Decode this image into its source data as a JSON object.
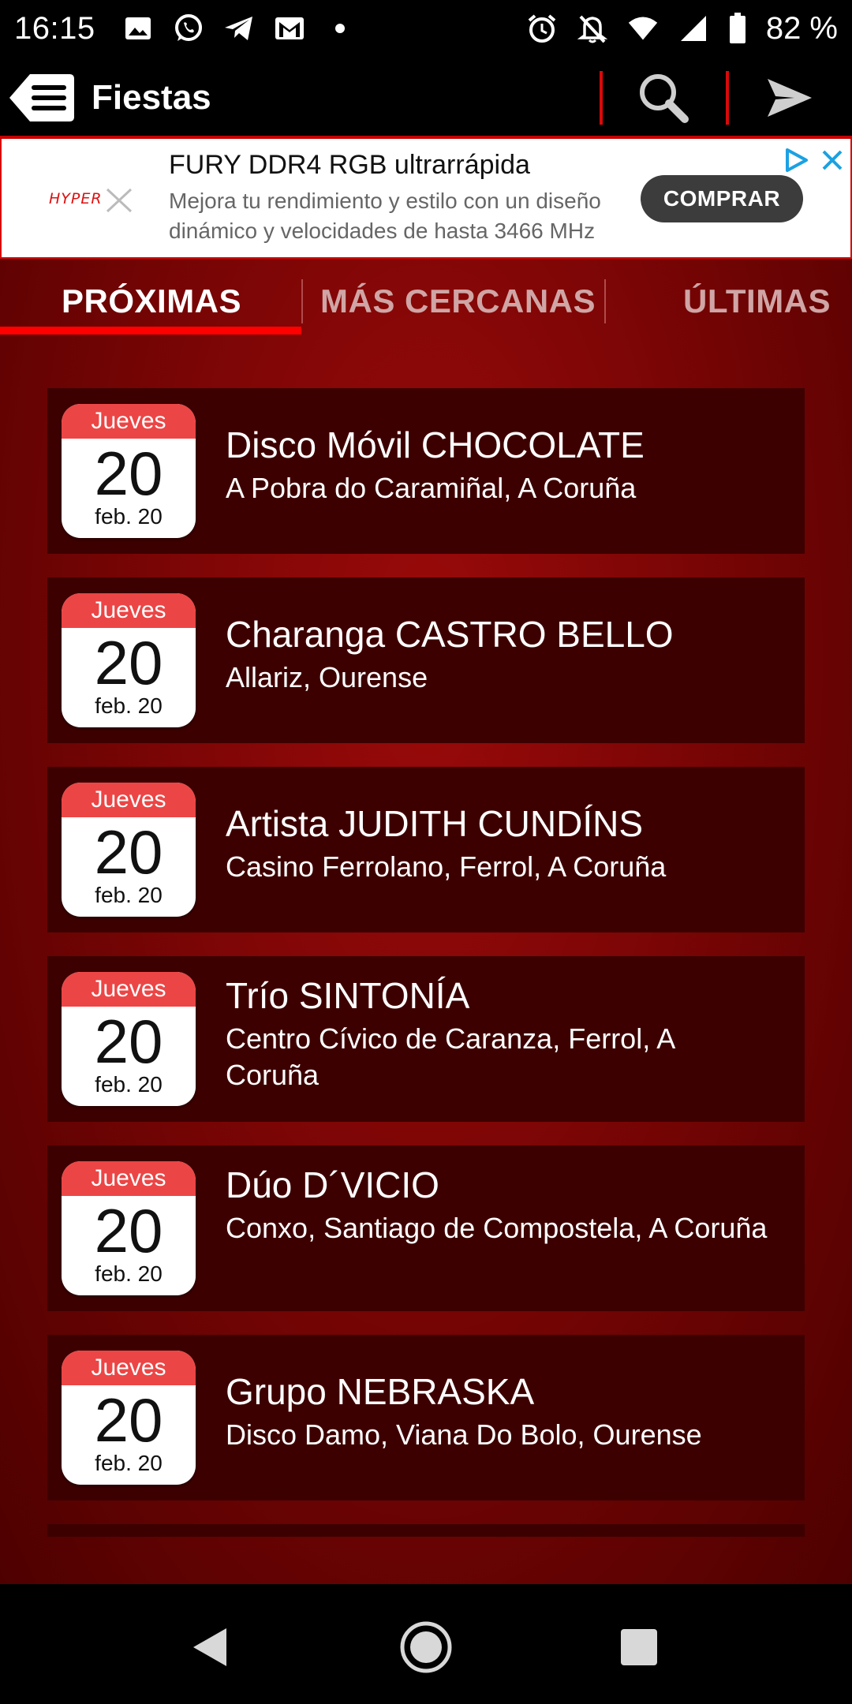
{
  "status_bar": {
    "time": "16:15",
    "battery": "82 %",
    "left_icons": [
      "image-icon",
      "whatsapp-icon",
      "telegram-icon",
      "gmail-icon",
      "dot-icon"
    ],
    "right_icons": [
      "alarm-icon",
      "bell-off-icon",
      "wifi-icon",
      "signal-icon",
      "battery-icon"
    ]
  },
  "app_bar": {
    "title": "Fiestas",
    "accent": "#d90a0a"
  },
  "ad": {
    "brand": "HYPERX",
    "title": "FURY DDR4 RGB ultrarrápida",
    "description": "Mejora tu rendimiento y estilo con un diseño dinámico y velocidades de hasta 3466 MHz",
    "cta": "COMPRAR"
  },
  "tabs": [
    {
      "label": "PRÓXIMAS",
      "active": true
    },
    {
      "label": "MÁS CERCANAS",
      "active": false
    },
    {
      "label": "ÚLTIMAS",
      "active": false
    }
  ],
  "events": [
    {
      "weekday": "Jueves",
      "day": "20",
      "month": "feb. 20",
      "title": "Disco Móvil CHOCOLATE",
      "place": "A Pobra do Caramiñal, A Coruña"
    },
    {
      "weekday": "Jueves",
      "day": "20",
      "month": "feb. 20",
      "title": "Charanga CASTRO BELLO",
      "place": "Allariz, Ourense"
    },
    {
      "weekday": "Jueves",
      "day": "20",
      "month": "feb. 20",
      "title": "Artista JUDITH CUNDÍNS",
      "place": "Casino Ferrolano, Ferrol, A Coruña"
    },
    {
      "weekday": "Jueves",
      "day": "20",
      "month": "feb. 20",
      "title": "Trío SINTONÍA",
      "place": "Centro Cívico de Caranza, Ferrol, A Coruña"
    },
    {
      "weekday": "Jueves",
      "day": "20",
      "month": "feb. 20",
      "title": "Dúo D´VICIO",
      "place": "Conxo, Santiago de Compostela, A Coruña"
    },
    {
      "weekday": "Jueves",
      "day": "20",
      "month": "feb. 20",
      "title": "Grupo NEBRASKA",
      "place": "Disco Damo, Viana Do Bolo, Ourense"
    }
  ],
  "colors": {
    "calendar_header": "#ec4545",
    "card_bg": "#3d0000",
    "tab_underline": "#ff0000"
  }
}
